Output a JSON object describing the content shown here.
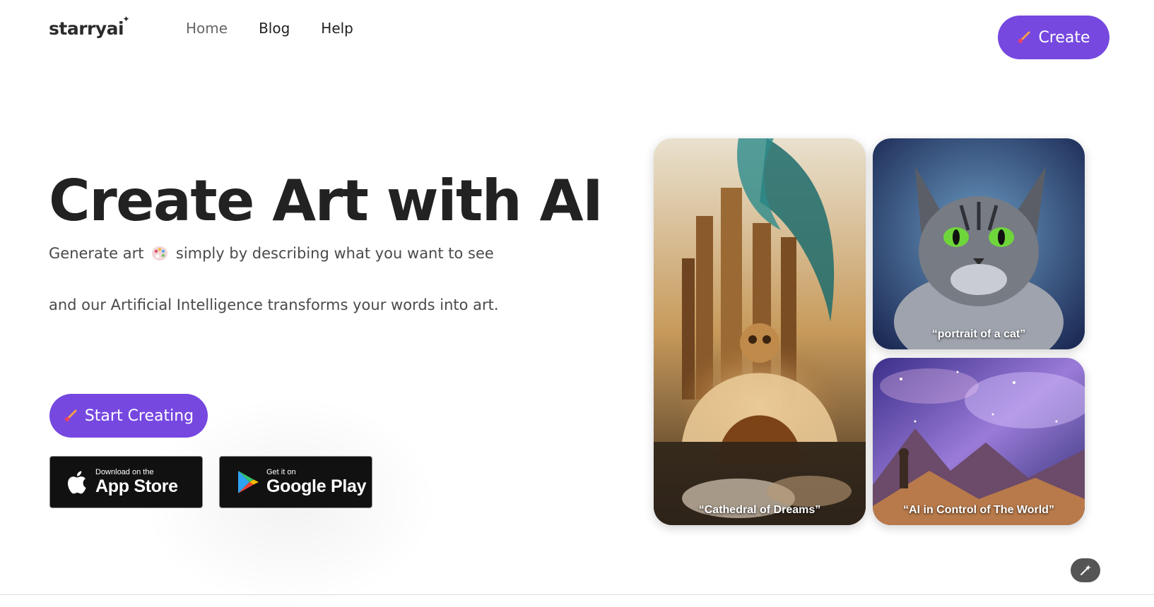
{
  "brand": {
    "logo_text": "starryai",
    "accent_color": "#7648e0"
  },
  "nav": {
    "items": [
      {
        "label": "Home",
        "active": true
      },
      {
        "label": "Blog",
        "active": false
      },
      {
        "label": "Help",
        "active": false
      }
    ],
    "create_label": "Create"
  },
  "hero": {
    "title": "Create Art with AI",
    "subtitle_part1": "Generate art",
    "subtitle_icon": "palette-icon",
    "subtitle_part2": "simply by describing what you want to see",
    "subtitle_line2": "and our Artificial Intelligence transforms your words into art.",
    "cta_label": "Start Creating"
  },
  "stores": {
    "apple": {
      "small": "Download on the",
      "big": "App Store",
      "icon": "apple-icon"
    },
    "google": {
      "small": "Get it on",
      "big": "Google Play",
      "icon": "google-play-icon"
    }
  },
  "gallery": [
    {
      "caption": "“Cathedral of Dreams”"
    },
    {
      "caption": "“portrait of a cat”"
    },
    {
      "caption": "“AI in Control of The World”"
    }
  ],
  "fab": {
    "icon": "magic-wand-icon"
  }
}
